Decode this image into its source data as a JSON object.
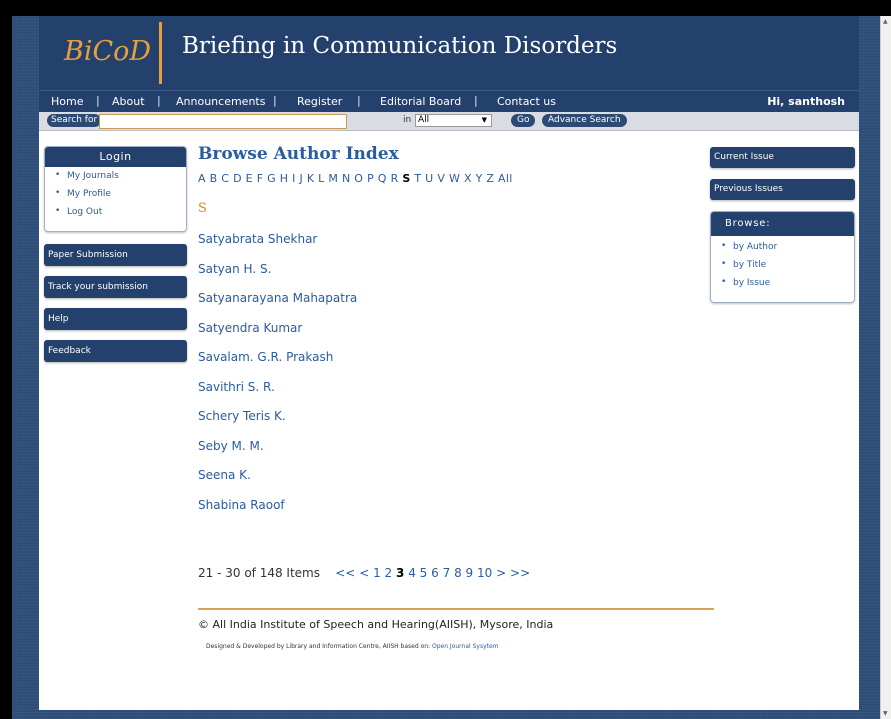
{
  "site": {
    "logo": "BiCoD",
    "title": "Briefing in Communication Disorders"
  },
  "nav": {
    "items": [
      "Home",
      "About",
      "Announcements",
      "Register",
      "Editorial Board",
      "Contact us"
    ],
    "greeting": "Hi, santhosh"
  },
  "search": {
    "label": "Search for",
    "value": "",
    "in_label": "in",
    "scope": "All",
    "go": "Go",
    "advanced": "Advance Search"
  },
  "left_sidebar": {
    "login_title": "Login",
    "login_links": [
      "My Journals",
      "My Profile",
      "Log Out"
    ],
    "buttons": [
      "Paper Submission",
      "Track your submission",
      "Help",
      "Feedback"
    ]
  },
  "main": {
    "heading": "Browse Author Index",
    "alphabet": [
      "A",
      "B",
      "C",
      "D",
      "E",
      "F",
      "G",
      "H",
      "I",
      "J",
      "K",
      "L",
      "M",
      "N",
      "O",
      "P",
      "Q",
      "R",
      "S",
      "T",
      "U",
      "V",
      "W",
      "X",
      "Y",
      "Z",
      "All"
    ],
    "current_letter": "S",
    "authors": [
      "Satyabrata Shekhar",
      "Satyan H. S.",
      "Satyanarayana Mahapatra",
      "Satyendra Kumar",
      "Savalam. G.R. Prakash",
      "Savithri S. R.",
      "Schery Teris K.",
      "Seby M. M.",
      "Seena K.",
      "Shabina Raoof"
    ],
    "pagination": {
      "summary": "21 - 30 of 148 Items",
      "first": "<<",
      "prev": "<",
      "pages": [
        "1",
        "2",
        "3",
        "4",
        "5",
        "6",
        "7",
        "8",
        "9",
        "10"
      ],
      "current": "3",
      "next": ">",
      "last": ">>"
    }
  },
  "footer": {
    "copyright": "© All India Institute of Speech and Hearing(AIISH), Mysore, India",
    "credits": "Designed & Developed by Library and Information Centre, AIISH based on:",
    "ojs_link": "Open Journal Sysytem"
  },
  "right_sidebar": {
    "current_issue": "Current Issue",
    "previous_issues": "Previous Issues",
    "browse_title": "Browse:",
    "browse_links": [
      "by Author",
      "by Title",
      "by Issue"
    ]
  }
}
